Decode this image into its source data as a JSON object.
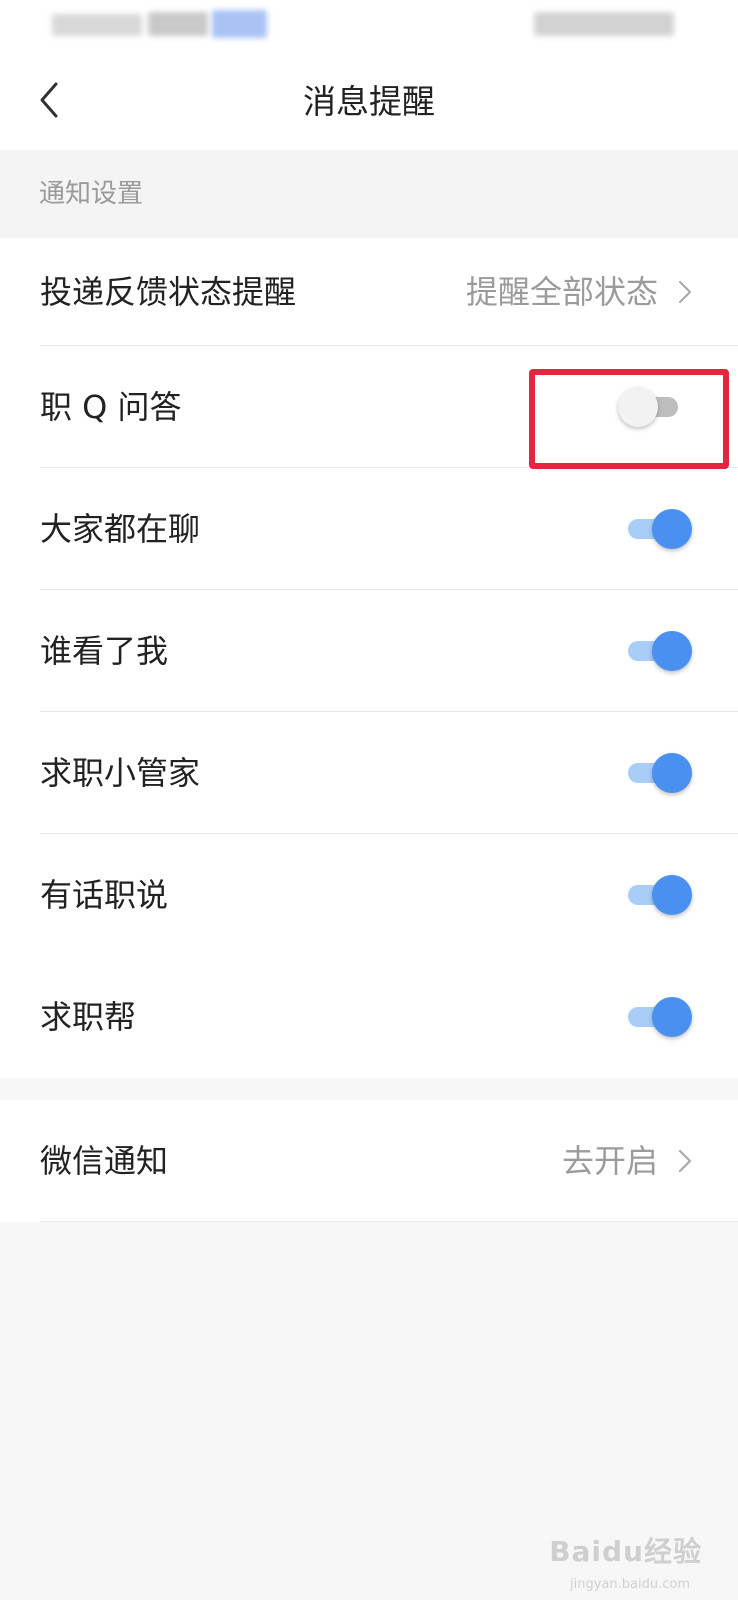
{
  "header": {
    "title": "消息提醒",
    "back_icon": "chevron-left-icon"
  },
  "section": {
    "title": "通知设置"
  },
  "rows": [
    {
      "label": "投递反馈状态提醒",
      "value": "提醒全部状态",
      "type": "link"
    },
    {
      "label": "职 Q 问答",
      "type": "toggle",
      "on": false
    },
    {
      "label": "大家都在聊",
      "type": "toggle",
      "on": true
    },
    {
      "label": "谁看了我",
      "type": "toggle",
      "on": true
    },
    {
      "label": "求职小管家",
      "type": "toggle",
      "on": true
    },
    {
      "label": "有话职说",
      "type": "toggle",
      "on": true
    },
    {
      "label": "求职帮",
      "type": "toggle",
      "on": true
    }
  ],
  "wechat": {
    "label": "微信通知",
    "value": "去开启"
  },
  "watermark": {
    "text": "Baidu经验",
    "sub": "jingyan.baidu.com"
  },
  "colors": {
    "toggle_on": "#4a90f0",
    "toggle_off": "#f2f2f2",
    "highlight": "#e3263f"
  }
}
